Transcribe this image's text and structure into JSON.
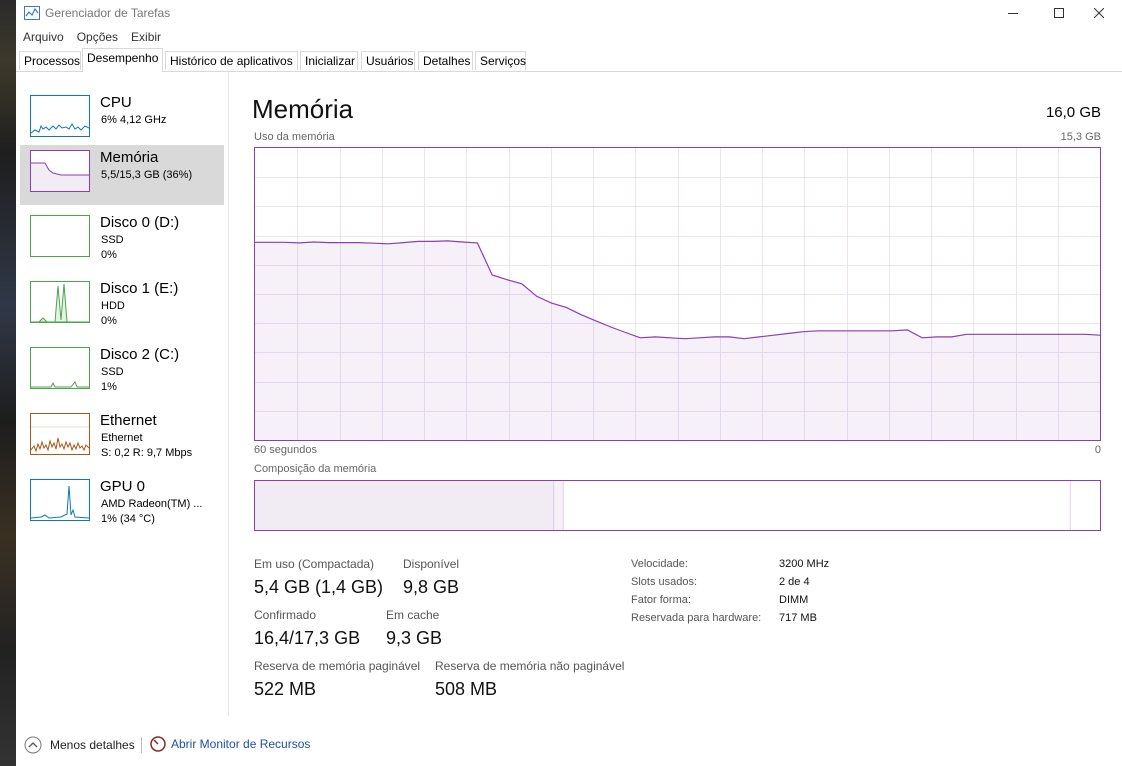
{
  "window": {
    "title": "Gerenciador de Tarefas"
  },
  "menu": [
    "Arquivo",
    "Opções",
    "Exibir"
  ],
  "tabs": [
    "Processos",
    "Desempenho",
    "Histórico de aplicativos",
    "Inicializar",
    "Usuários",
    "Detalhes",
    "Serviços"
  ],
  "active_tab": "Desempenho",
  "sidebar": [
    {
      "name": "CPU",
      "line1": "6% 4,12 GHz",
      "line2": "",
      "color": "#1278b8"
    },
    {
      "name": "Memória",
      "line1": "5,5/15,3 GB (36%)",
      "line2": "",
      "color": "#8b3db8"
    },
    {
      "name": "Disco 0 (D:)",
      "line1": "SSD",
      "line2": "0%",
      "color": "#4da24d"
    },
    {
      "name": "Disco 1 (E:)",
      "line1": "HDD",
      "line2": "0%",
      "color": "#4da24d"
    },
    {
      "name": "Disco 2 (C:)",
      "line1": "SSD",
      "line2": "1%",
      "color": "#4da24d"
    },
    {
      "name": "Ethernet",
      "line1": "Ethernet",
      "line2": "S: 0,2  R: 9,7 Mbps",
      "color": "#a7581b"
    },
    {
      "name": "GPU 0",
      "line1": "AMD Radeon(TM) ...",
      "line2": "1% (34 °C)",
      "color": "#1278b8"
    }
  ],
  "memory": {
    "title": "Memória",
    "total": "16,0 GB",
    "usage_label": "Uso da memória",
    "usage_max": "15,3 GB",
    "time_left": "60 segundos",
    "time_right": "0",
    "composition_label": "Composição da memória",
    "usage_graph_percent": [
      67.7,
      67.7,
      67.7,
      67.5,
      67.8,
      67.6,
      67.6,
      67.6,
      67.4,
      67.2,
      67.6,
      68.0,
      68.0,
      68.2,
      67.8,
      67.5,
      56.5,
      54.9,
      53.5,
      49.2,
      46.9,
      45.4,
      42.9,
      40.8,
      38.7,
      36.8,
      35.0,
      35.3,
      35.0,
      34.7,
      35.0,
      35.3,
      35.3,
      34.7,
      35.3,
      35.9,
      36.5,
      37.1,
      37.4,
      37.4,
      37.4,
      37.4,
      37.4,
      37.4,
      37.7,
      35.0,
      35.3,
      35.3,
      36.2,
      36.2,
      36.2,
      36.2,
      36.2,
      36.2,
      36.2,
      36.2,
      36.2,
      35.9
    ],
    "composition_fractions": {
      "in_use": 0.354,
      "modified": 0.011,
      "standby": 0.6,
      "free": 0.035
    },
    "stats": {
      "in_use_label": "Em uso (Compactada)",
      "in_use_value": "5,4 GB (1,4 GB)",
      "available_label": "Disponível",
      "available_value": "9,8 GB",
      "committed_label": "Confirmado",
      "committed_value": "16,4/17,3 GB",
      "cached_label": "Em cache",
      "cached_value": "9,3 GB",
      "paged_label": "Reserva de memória paginável",
      "paged_value": "522 MB",
      "nonpaged_label": "Reserva de memória não paginável",
      "nonpaged_value": "508 MB"
    },
    "details": [
      {
        "k": "Velocidade:",
        "v": "3200 MHz"
      },
      {
        "k": "Slots usados:",
        "v": "2 de 4"
      },
      {
        "k": "Fator forma:",
        "v": "DIMM"
      },
      {
        "k": "Reservada para hardware:",
        "v": "717 MB"
      }
    ]
  },
  "bottom": {
    "less_details": "Menos detalhes",
    "resource_monitor": "Abrir Monitor de Recursos"
  }
}
